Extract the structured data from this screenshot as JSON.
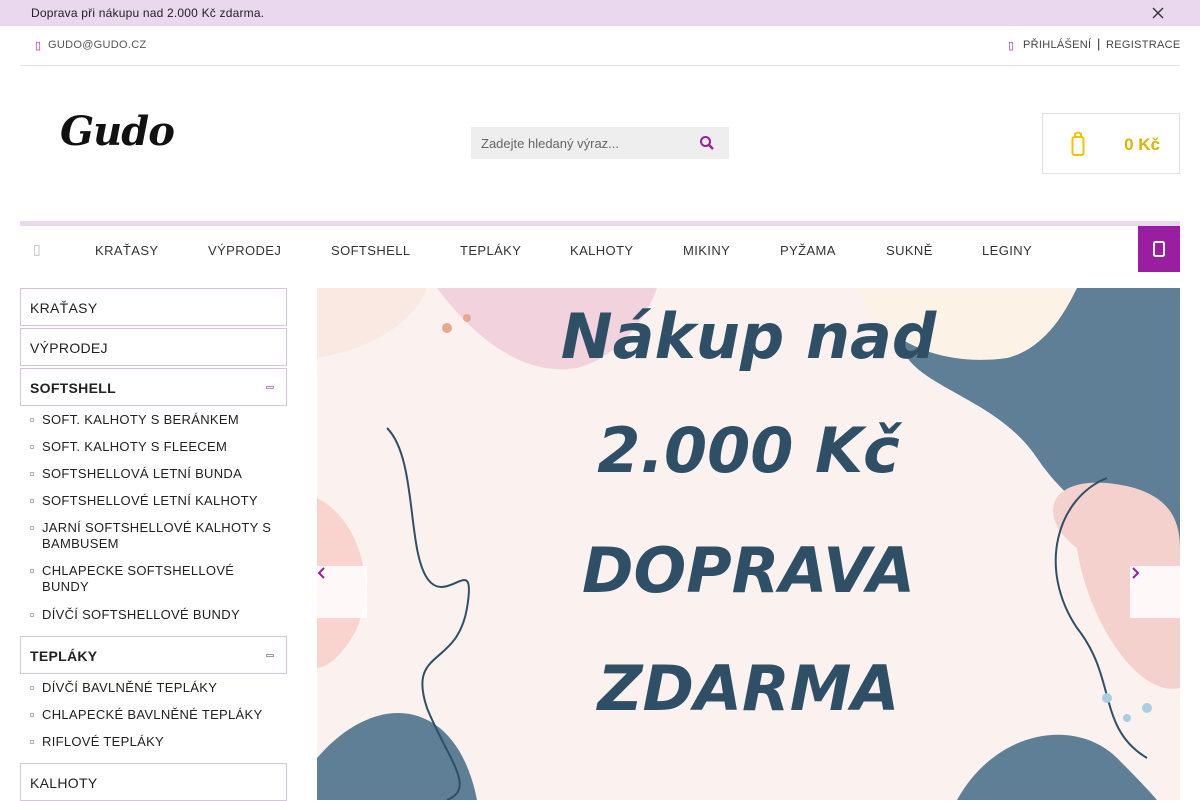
{
  "topbar": {
    "text": "Doprava při nákupu nad 2.000 Kč zdarma.",
    "close_icon": "close-icon"
  },
  "contact": {
    "email": "GUDO@GUDO.CZ",
    "login": "PŘIHLÁŠENÍ",
    "separator": "|",
    "register": "REGISTRACE"
  },
  "logo": {
    "text": "Gudo"
  },
  "search": {
    "placeholder": "Zadejte hledaný výraz...",
    "icon": "search-icon"
  },
  "cart": {
    "price": "0 Kč",
    "icon": "cart-icon"
  },
  "nav": {
    "items": [
      "KRAŤASY",
      "VÝPRODEJ",
      "SOFTSHELL",
      "TEPLÁKY",
      "KALHOTY",
      "MIKINY",
      "PYŽAMA",
      "SUKNĚ",
      "LEGINY"
    ]
  },
  "sidebar": {
    "categories": [
      {
        "label": "KRAŤASY"
      },
      {
        "label": "VÝPRODEJ"
      },
      {
        "label": "SOFTSHELL",
        "subitems": [
          "SOFT. KALHOTY S BERÁNKEM",
          "SOFT. KALHOTY S FLEECEM",
          "SOFTSHELLOVÁ LETNÍ BUNDA",
          "SOFTSHELLOVÉ LETNÍ KALHOTY",
          "JARNÍ SOFTSHELLOVÉ KALHOTY S BAMBUSEM",
          "CHLAPECKE SOFTSHELLOVÉ BUNDY",
          "DÍVČÍ SOFTSHELLOVÉ BUNDY"
        ]
      },
      {
        "label": "TEPLÁKY",
        "subitems": [
          "DÍVČÍ BAVLNĚNÉ TEPLÁKY",
          "CHLAPECKÉ BAVLNĚNÉ TEPLÁKY",
          "RIFLOVÉ TEPLÁKY"
        ]
      },
      {
        "label": "KALHOTY"
      }
    ]
  },
  "banner": {
    "lines": [
      "Nákup nad",
      "2.000 Kč",
      "DOPRAVA",
      "ZDARMA"
    ]
  },
  "colors": {
    "accent": "#9a1ea0",
    "topbar_bg": "#ead9ee",
    "cart_price": "#d9b400",
    "banner_text": "#2f4f67"
  }
}
